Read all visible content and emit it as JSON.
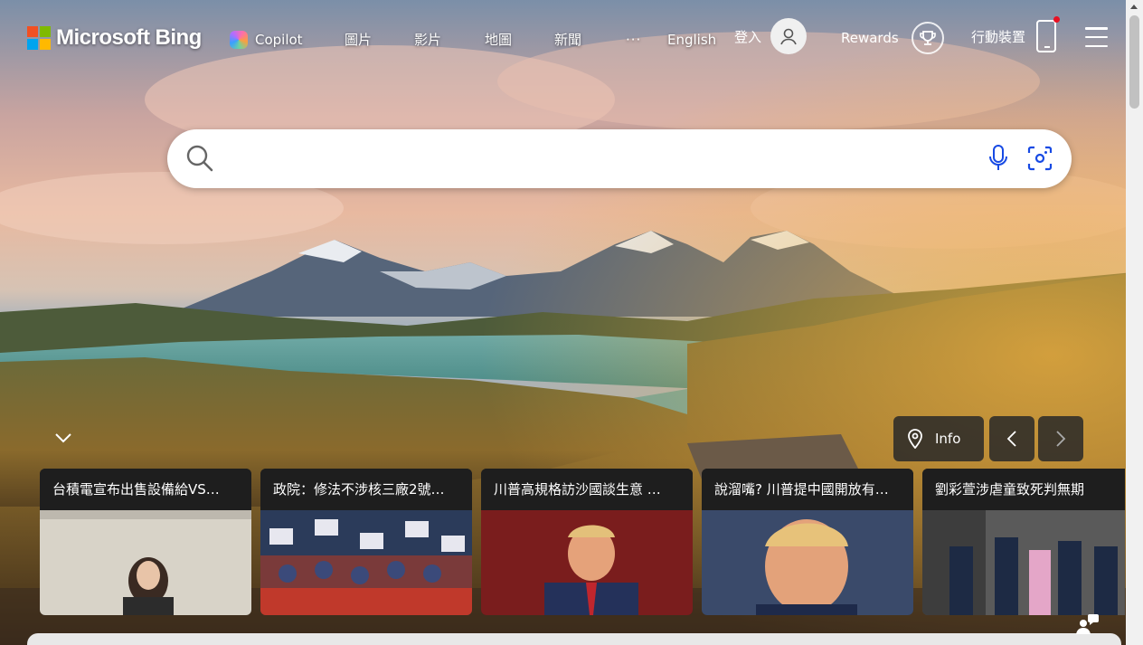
{
  "header": {
    "logo_text": "Microsoft",
    "logo_bing": "Bing",
    "nav": {
      "copilot": "Copilot",
      "images": "圖片",
      "videos": "影片",
      "maps": "地圖",
      "news": "新聞",
      "more": "···",
      "english": "English"
    },
    "signin_label": "登入",
    "rewards_label": "Rewards",
    "mobile_label": "行動裝置"
  },
  "search": {
    "value": "",
    "placeholder": ""
  },
  "background": {
    "info_label": "Info"
  },
  "news": {
    "cards": [
      {
        "title": "台積電宣布出售設備給VS…"
      },
      {
        "title": "政院：修法不涉核三廠2號…"
      },
      {
        "title": "川普高規格訪沙國談生意 …"
      },
      {
        "title": "說溜嘴? 川普提中國開放有…"
      },
      {
        "title": "劉彩萱涉虐童致死判無期"
      }
    ]
  },
  "colors": {
    "accent_blue": "#174ae4",
    "rewards_red_dot": "#e81123",
    "card_bg": "#1e1e1e"
  },
  "icons": {
    "search": "search-icon",
    "mic": "microphone-icon",
    "visual_search": "visual-search-icon",
    "location": "location-pin-icon",
    "trophy": "trophy-icon",
    "phone": "phone-icon",
    "user": "user-icon",
    "menu": "hamburger-menu-icon",
    "chevron_down": "chevron-down-icon",
    "chevron_left": "chevron-left-icon",
    "chevron_right": "chevron-right-icon",
    "feedback": "feedback-icon"
  }
}
